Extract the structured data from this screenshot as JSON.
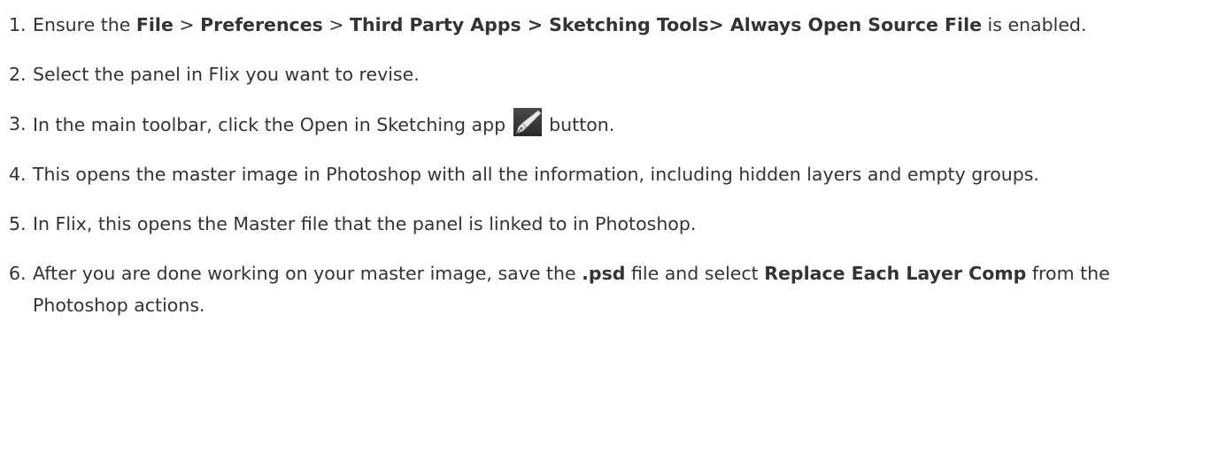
{
  "steps": [
    {
      "num": "1.",
      "parts": [
        {
          "t": "Ensure the "
        },
        {
          "b": "File"
        },
        {
          "t": " > "
        },
        {
          "b": "Preferences"
        },
        {
          "t": " > "
        },
        {
          "b": "Third Party Apps > Sketching Tools> Always Open Source File"
        },
        {
          "t": " is enabled."
        }
      ]
    },
    {
      "num": "2.",
      "parts": [
        {
          "t": "Select the panel in Flix you want to revise."
        }
      ]
    },
    {
      "num": "3.",
      "parts": [
        {
          "t": "In the main toolbar, click the Open in Sketching app "
        },
        {
          "icon": "pen-nib-icon"
        },
        {
          "t": " button."
        }
      ]
    },
    {
      "num": "4.",
      "parts": [
        {
          "t": "This opens the master image in Photoshop with all the information, including hidden layers and empty groups."
        }
      ]
    },
    {
      "num": "5.",
      "parts": [
        {
          "t": "In Flix, this opens the Master file that the panel is linked to in Photoshop."
        }
      ]
    },
    {
      "num": "6.",
      "parts": [
        {
          "t": "After you are done working on your master image, save the "
        },
        {
          "b": ".psd"
        },
        {
          "t": " file and select "
        },
        {
          "b": "Replace Each Layer Comp"
        },
        {
          "t": " from the Photoshop actions."
        }
      ]
    }
  ],
  "colors": {
    "text": "#333333",
    "background": "#ffffff",
    "icon_bg": "#3b3b3b"
  }
}
